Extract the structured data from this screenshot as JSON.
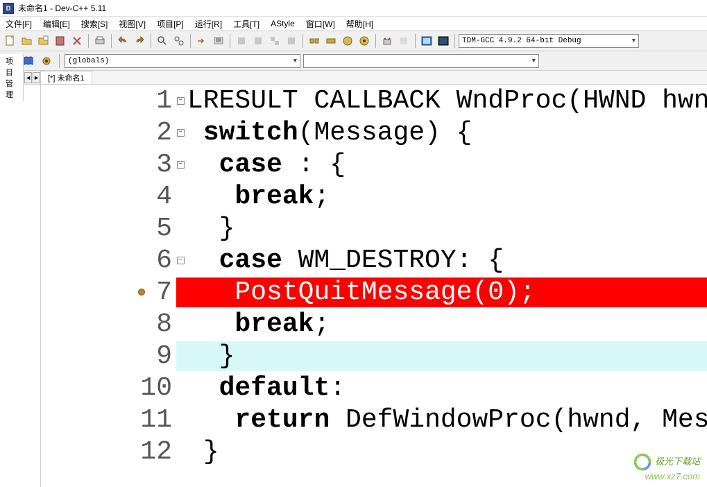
{
  "title": "未命名1 - Dev-C++ 5.11",
  "menu": {
    "file": "文件[F]",
    "edit": "编辑[E]",
    "search": "搜索[S]",
    "view": "视图[V]",
    "project": "项目[P]",
    "run": "运行[R]",
    "tools": "工具[T]",
    "astyle": "AStyle",
    "window": "窗口[W]",
    "help": "帮助[H]"
  },
  "toolbar": {
    "compiler_combo": "TDM-GCC 4.9.2 64-bit Debug",
    "globals_combo": "(globals)"
  },
  "sidebar": {
    "tab1": "项目管理"
  },
  "editor": {
    "tab1": "[*] 未命名1"
  },
  "code": {
    "lines": [
      {
        "n": "1",
        "txt_pre": "",
        "kw": "",
        "txt": "LRESULT CALLBACK WndProc(HWND hwnd, U",
        "fold": "-"
      },
      {
        "n": "2",
        "txt_pre": " ",
        "kw": "switch",
        "txt": "(Message) {",
        "fold": "-"
      },
      {
        "n": "3",
        "txt_pre": "  ",
        "kw": "case",
        "txt": " : {",
        "fold": "-"
      },
      {
        "n": "4",
        "txt_pre": "   ",
        "kw": "break",
        "txt": ";"
      },
      {
        "n": "5",
        "txt_pre": "  ",
        "kw": "",
        "txt": "}"
      },
      {
        "n": "6",
        "txt_pre": "  ",
        "kw": "case",
        "txt": " WM_DESTROY: {",
        "fold": "-"
      },
      {
        "n": "7",
        "txt_pre": "   ",
        "kw": "",
        "txt": "PostQuitMessage(0);",
        "hl": "red",
        "bp": true
      },
      {
        "n": "8",
        "txt_pre": "   ",
        "kw": "break",
        "txt": ";"
      },
      {
        "n": "9",
        "txt_pre": "  ",
        "kw": "",
        "txt": "}",
        "hl": "cyan"
      },
      {
        "n": "10",
        "txt_pre": "  ",
        "kw": "default",
        "txt": ":"
      },
      {
        "n": "11",
        "txt_pre": "   ",
        "kw": "return",
        "txt": " DefWindowProc(hwnd, Message"
      },
      {
        "n": "12",
        "txt_pre": " ",
        "kw": "",
        "txt": "}"
      }
    ]
  },
  "watermark": {
    "line1": "极光下载站",
    "line2": "www.xz7.com"
  }
}
